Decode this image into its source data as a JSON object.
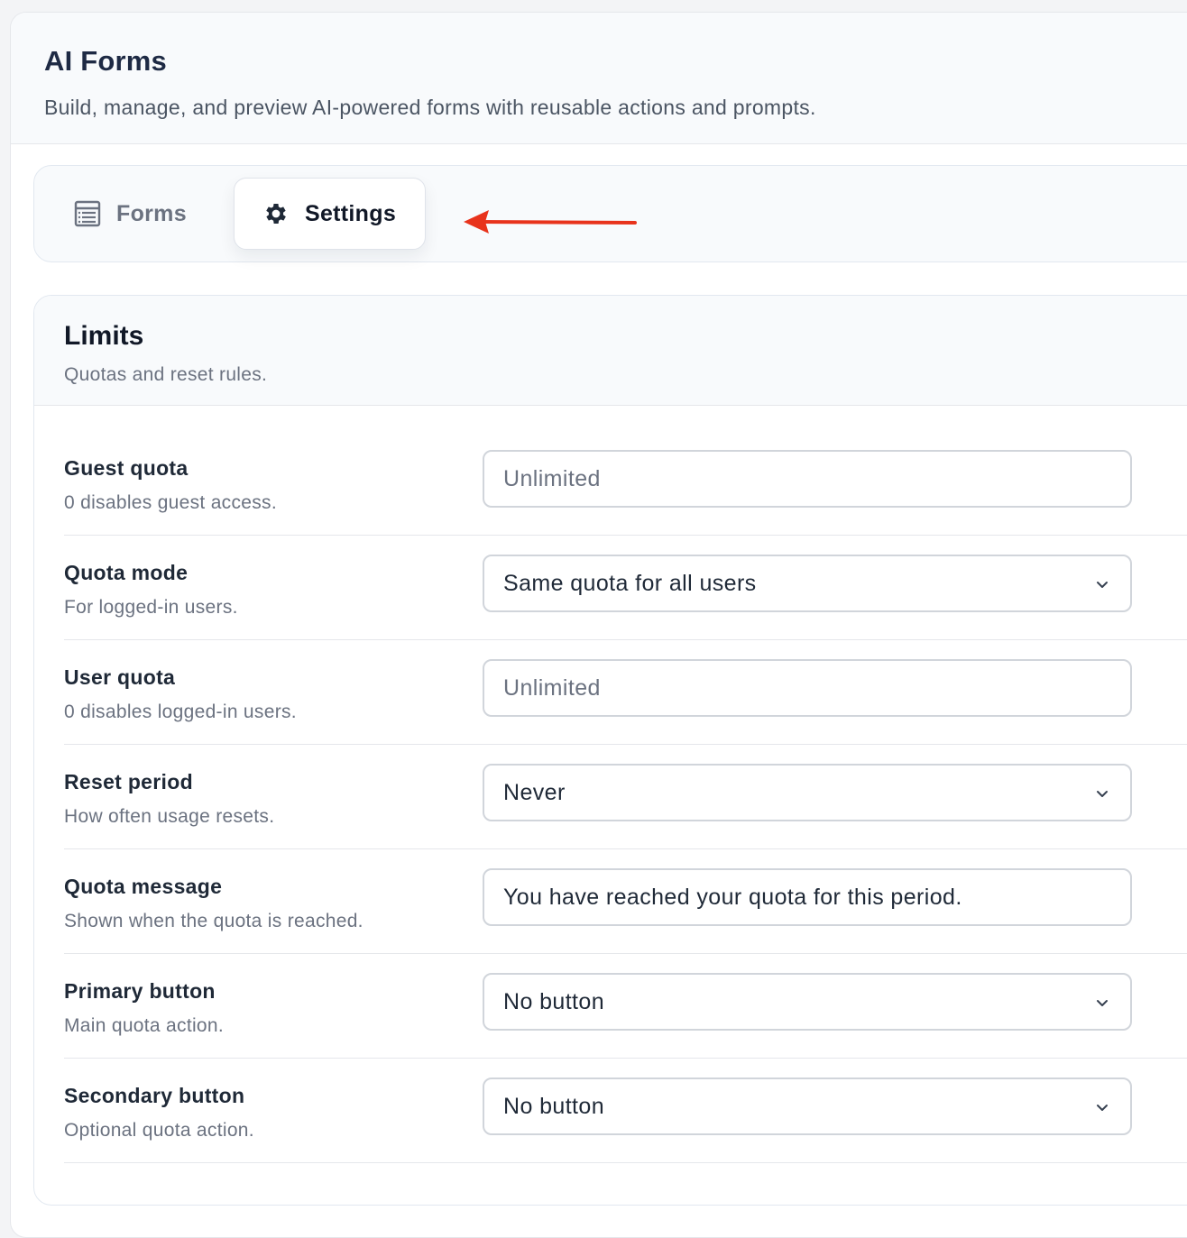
{
  "header": {
    "title": "AI Forms",
    "subtitle": "Build, manage, and preview AI-powered forms with reusable actions and prompts."
  },
  "tabs": [
    {
      "label": "Forms",
      "icon": "list-icon",
      "active": false
    },
    {
      "label": "Settings",
      "icon": "gear-icon",
      "active": true
    }
  ],
  "annotation": {
    "color": "#e8331c",
    "icon": "arrow-left-icon"
  },
  "limits": {
    "title": "Limits",
    "subtitle": "Quotas and reset rules.",
    "rows": [
      {
        "label": "Guest quota",
        "help": "0 disables guest access.",
        "type": "input",
        "value": "",
        "placeholder": "Unlimited"
      },
      {
        "label": "Quota mode",
        "help": "For logged-in users.",
        "type": "select",
        "value": "Same quota for all users"
      },
      {
        "label": "User quota",
        "help": "0 disables logged-in users.",
        "type": "input",
        "value": "",
        "placeholder": "Unlimited"
      },
      {
        "label": "Reset period",
        "help": "How often usage resets.",
        "type": "select",
        "value": "Never"
      },
      {
        "label": "Quota message",
        "help": "Shown when the quota is reached.",
        "type": "input",
        "value": "You have reached your quota for this period."
      },
      {
        "label": "Primary button",
        "help": "Main quota action.",
        "type": "select",
        "value": "No button"
      },
      {
        "label": "Secondary button",
        "help": "Optional quota action.",
        "type": "select",
        "value": "No button"
      }
    ]
  }
}
